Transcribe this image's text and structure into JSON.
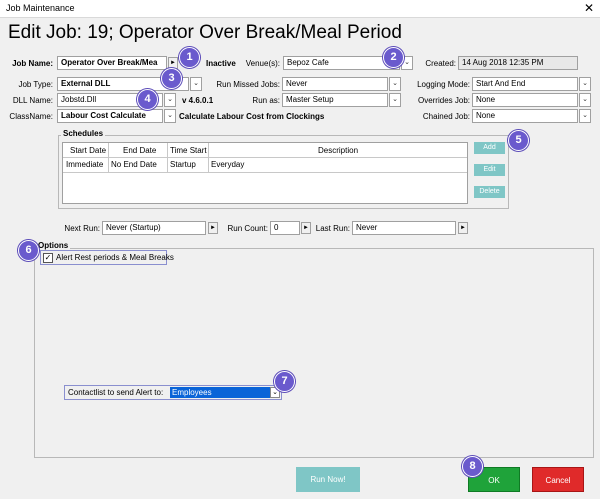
{
  "window": {
    "title": "Job Maintenance",
    "close_glyph": "✕"
  },
  "heading": "Edit Job: 19; Operator Over Break/Meal Period",
  "fields": {
    "job_name": {
      "label": "Job Name:",
      "value": "Operator Over Break/Mea"
    },
    "inactive_label": "Inactive",
    "venues": {
      "label": "Venue(s):",
      "value": "Bepoz Cafe"
    },
    "created": {
      "label": "Created:",
      "value": "14 Aug 2018 12:35 PM"
    },
    "job_type": {
      "label": "Job Type:",
      "value": "External DLL"
    },
    "run_missed_jobs": {
      "label": "Run Missed Jobs:",
      "value": "Never"
    },
    "logging_mode": {
      "label": "Logging Mode:",
      "value": "Start And End"
    },
    "dll_name": {
      "label": "DLL Name:",
      "value": "Jobstd.Dll"
    },
    "version": "v 4.6.0.1",
    "run_as": {
      "label": "Run as:",
      "value": "Master Setup"
    },
    "overrides_job": {
      "label": "Overrides Job:",
      "value": "None"
    },
    "class_name": {
      "label": "ClassName:",
      "value": "Labour Cost Calculate"
    },
    "class_desc": "Calculate Labour Cost from Clockings",
    "chained_job": {
      "label": "Chained Job:",
      "value": "None"
    }
  },
  "schedules": {
    "title": "Schedules",
    "columns": [
      "Start Date",
      "End Date",
      "Time Start",
      "Description"
    ],
    "rows": [
      [
        "Immediate",
        "No End Date",
        "Startup",
        "Everyday"
      ]
    ],
    "buttons": {
      "add": "Add",
      "edit": "Edit",
      "delete": "Delete"
    }
  },
  "run_info": {
    "next_run_label": "Next Run:",
    "next_run_value": "Never (Startup)",
    "run_count_label": "Run Count:",
    "run_count_value": "0",
    "last_run_label": "Last Run:",
    "last_run_value": "Never"
  },
  "options": {
    "title": "Options",
    "checkbox_label": "Alert Rest periods & Meal Breaks",
    "checked": true,
    "contact_label": "Contactlist to send Alert to:",
    "contact_value": "Employees"
  },
  "footer": {
    "run_now": "Run Now!",
    "ok": "OK",
    "cancel": "Cancel"
  },
  "callouts": [
    "1",
    "2",
    "3",
    "4",
    "5",
    "6",
    "7",
    "8"
  ],
  "colors": {
    "callout": "#6a5acd",
    "ok": "#1fa33a",
    "cancel": "#e02a2a",
    "teal": "#7fc6c6",
    "select_blue": "#0a64d8"
  },
  "icons": {
    "arrow": "►",
    "dropdown": "⌄",
    "check": "✓"
  }
}
